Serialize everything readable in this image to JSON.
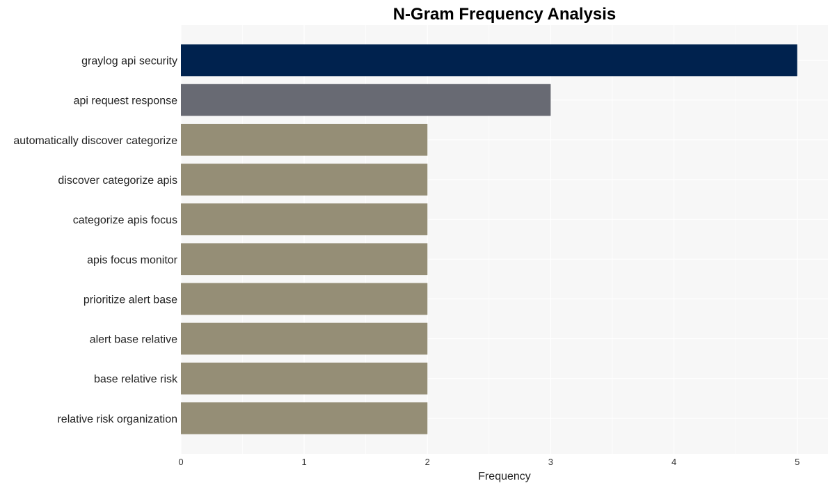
{
  "chart_data": {
    "type": "bar",
    "orientation": "horizontal",
    "title": "N-Gram Frequency Analysis",
    "xlabel": "Frequency",
    "ylabel": "",
    "xlim": [
      0,
      5.25
    ],
    "xticks": [
      0,
      1,
      2,
      3,
      4,
      5
    ],
    "grid": true,
    "legend": "none",
    "categories": [
      "graylog api security",
      "api request response",
      "automatically discover categorize",
      "discover categorize apis",
      "categorize apis focus",
      "apis focus monitor",
      "prioritize alert base",
      "alert base relative",
      "base relative risk",
      "relative risk organization"
    ],
    "values": [
      5,
      3,
      2,
      2,
      2,
      2,
      2,
      2,
      2,
      2
    ],
    "colors": [
      "#00224e",
      "#686a73",
      "#958e76",
      "#958e76",
      "#958e76",
      "#958e76",
      "#958e76",
      "#958e76",
      "#958e76",
      "#958e76"
    ],
    "background": "#f7f7f7",
    "gridline_color": "#ffffff"
  }
}
